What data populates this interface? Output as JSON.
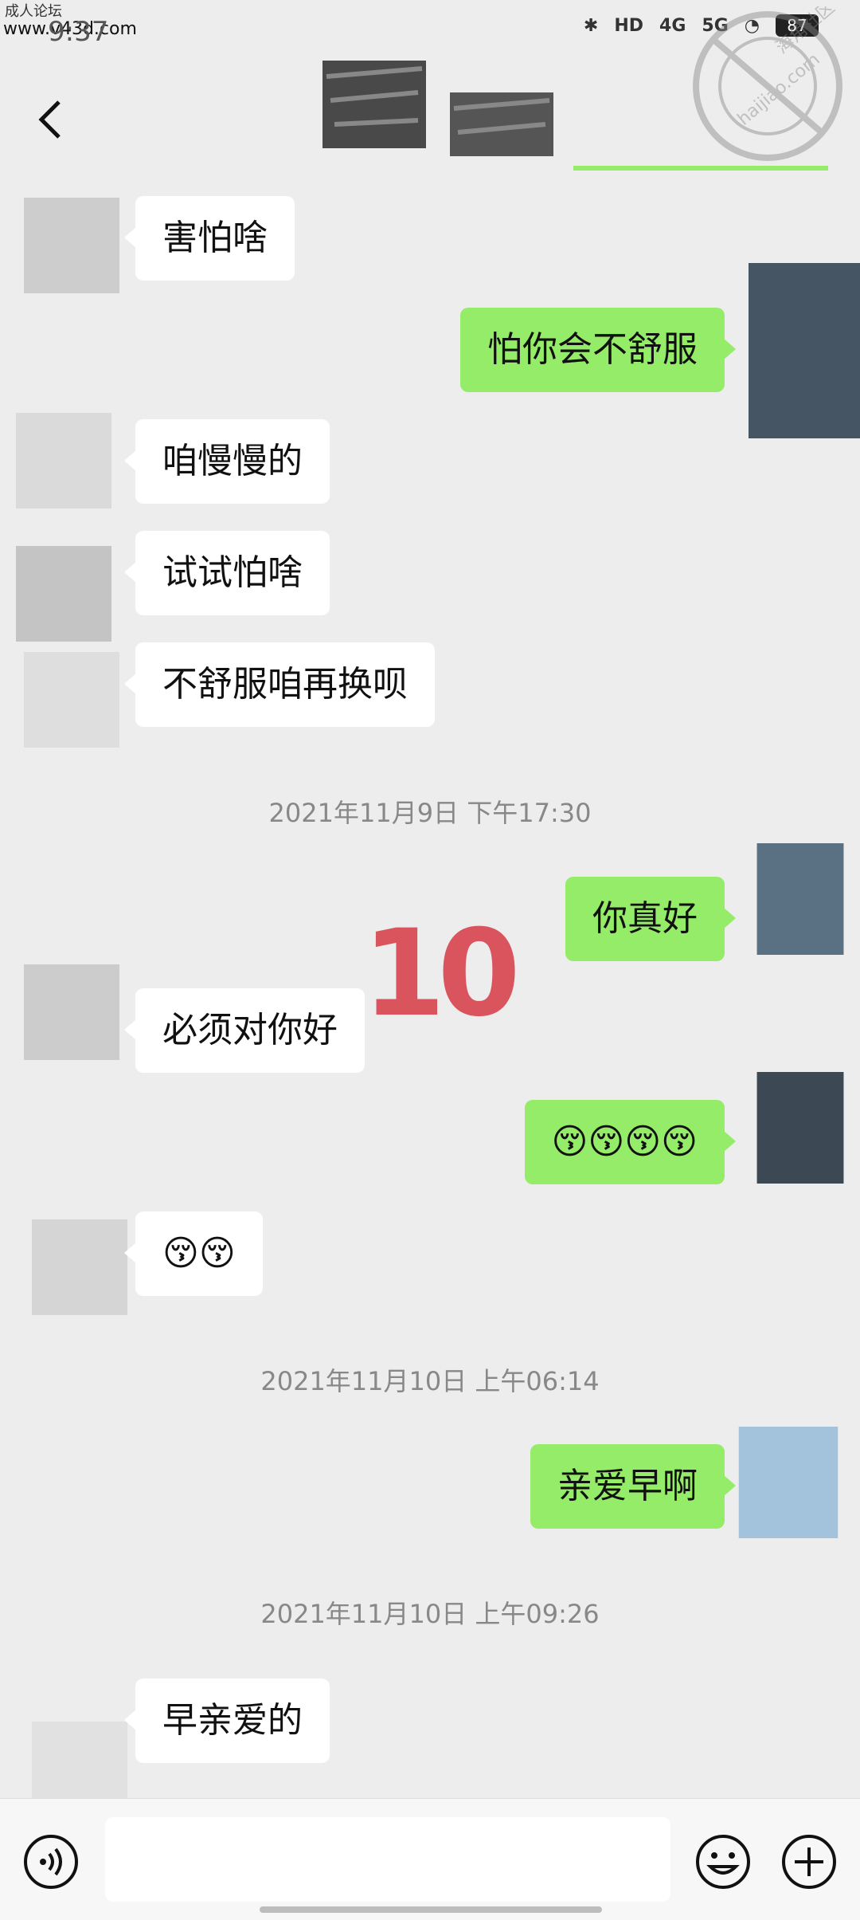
{
  "watermark": {
    "forum": "成人论坛",
    "site": "www.v43d.com"
  },
  "status_bar": {
    "time": "9:37",
    "battery": "87",
    "network_4g": "4G",
    "network_5g": "5G",
    "hd": "HD"
  },
  "stamp": {
    "text_cn": "海角社区",
    "text_en": "haijiao.com"
  },
  "overlay": {
    "number": "10"
  },
  "messages": [
    {
      "side": "in",
      "text": "害怕啥"
    },
    {
      "side": "out",
      "text": "怕你会不舒服"
    },
    {
      "side": "in",
      "text": "咱慢慢的"
    },
    {
      "side": "in",
      "text": "试试怕啥"
    },
    {
      "side": "in",
      "text": "不舒服咱再换呗"
    },
    {
      "type": "time",
      "text": "2021年11月9日 下午17:30"
    },
    {
      "side": "out",
      "text": "你真好"
    },
    {
      "side": "in",
      "text": "必须对你好"
    },
    {
      "side": "out",
      "text": "😚😚😚😚"
    },
    {
      "side": "in",
      "text": "😚😚"
    },
    {
      "type": "time",
      "text": "2021年11月10日 上午06:14"
    },
    {
      "side": "out",
      "text": "亲爱早啊"
    },
    {
      "type": "time",
      "text": "2021年11月10日 上午09:26"
    },
    {
      "side": "in",
      "text": "早亲爱的"
    }
  ],
  "input": {
    "value": ""
  }
}
